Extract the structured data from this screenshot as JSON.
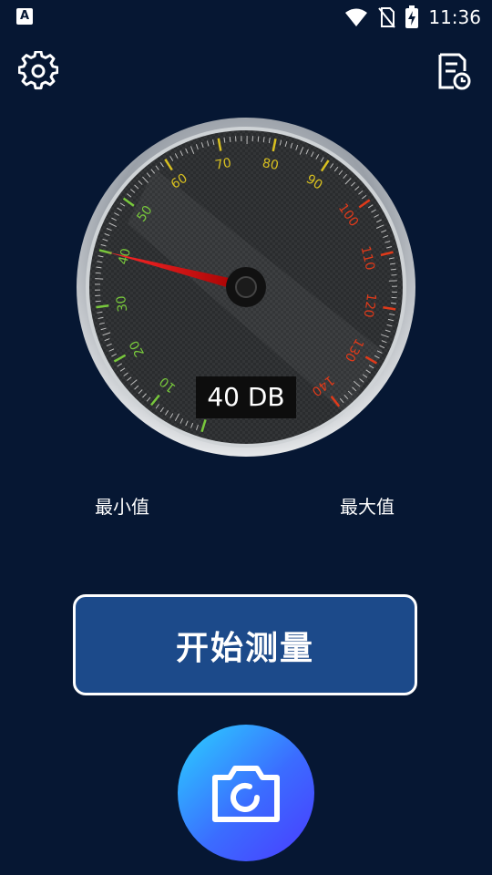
{
  "status_bar": {
    "app_badge": "A",
    "time": "11:36"
  },
  "toolbar": {
    "settings_icon": "gear-icon",
    "history_icon": "history-document-icon"
  },
  "gauge": {
    "reading": "40 DB",
    "value": 40,
    "min": 0,
    "max": 140,
    "ticks": [
      "0",
      "10",
      "20",
      "30",
      "40",
      "50",
      "60",
      "70",
      "80",
      "90",
      "100",
      "110",
      "120",
      "130",
      "140"
    ],
    "colors": {
      "low": "#78c83c",
      "mid": "#d8c020",
      "high": "#e03a1a"
    }
  },
  "labels": {
    "min": "最小值",
    "max": "最大值"
  },
  "buttons": {
    "start": "开始测量",
    "camera_icon": "camera-icon"
  }
}
